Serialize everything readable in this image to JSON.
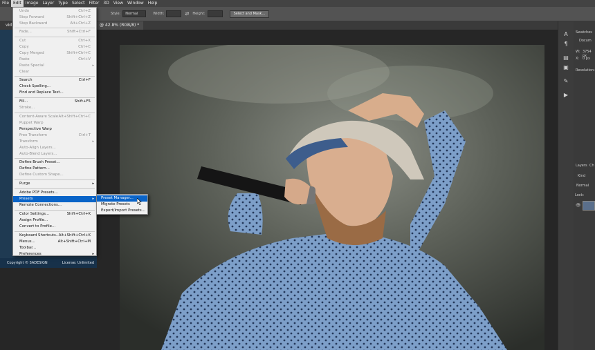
{
  "menubar": {
    "items": [
      "File",
      "Edit",
      "Image",
      "Layer",
      "Type",
      "Select",
      "Filter",
      "3D",
      "View",
      "Window",
      "Help"
    ]
  },
  "options": {
    "style_label": "Style:",
    "style_value": "Normal",
    "width_label": "Width:",
    "height_label": "Height:",
    "select_mask": "Select and Mask..."
  },
  "doc": {
    "tab_prefix": "vid",
    "tab_title": "@ 42.8% (RGB/8) *"
  },
  "edit_menu": {
    "items": [
      {
        "label": "Undo",
        "shortcut": "Ctrl+Z",
        "disabled": true
      },
      {
        "label": "Step Forward",
        "shortcut": "Shift+Ctrl+Z",
        "disabled": true
      },
      {
        "label": "Step Backward",
        "shortcut": "Alt+Ctrl+Z",
        "disabled": true
      },
      {
        "label": "Fade...",
        "shortcut": "Shift+Ctrl+F",
        "disabled": true
      },
      {
        "label": "Cut",
        "shortcut": "Ctrl+X",
        "disabled": true
      },
      {
        "label": "Copy",
        "shortcut": "Ctrl+C",
        "disabled": true
      },
      {
        "label": "Copy Merged",
        "shortcut": "Shift+Ctrl+C",
        "disabled": true
      },
      {
        "label": "Paste",
        "shortcut": "Ctrl+V",
        "disabled": true
      },
      {
        "label": "Paste Special",
        "shortcut": "",
        "disabled": true,
        "submenu": true
      },
      {
        "label": "Clear",
        "shortcut": "",
        "disabled": true
      },
      {
        "label": "Search",
        "shortcut": "Ctrl+F",
        "disabled": false
      },
      {
        "label": "Check Spelling...",
        "shortcut": "",
        "disabled": false
      },
      {
        "label": "Find and Replace Text...",
        "shortcut": "",
        "disabled": false
      },
      {
        "label": "Fill...",
        "shortcut": "Shift+F5",
        "disabled": false
      },
      {
        "label": "Stroke...",
        "shortcut": "",
        "disabled": true
      },
      {
        "label": "Content-Aware Scale",
        "shortcut": "Alt+Shift+Ctrl+C",
        "disabled": true
      },
      {
        "label": "Puppet Warp",
        "shortcut": "",
        "disabled": true
      },
      {
        "label": "Perspective Warp",
        "shortcut": "",
        "disabled": false
      },
      {
        "label": "Free Transform",
        "shortcut": "Ctrl+T",
        "disabled": true
      },
      {
        "label": "Transform",
        "shortcut": "",
        "disabled": true,
        "submenu": true
      },
      {
        "label": "Auto-Align Layers...",
        "shortcut": "",
        "disabled": true
      },
      {
        "label": "Auto-Blend Layers...",
        "shortcut": "",
        "disabled": true
      },
      {
        "label": "Define Brush Preset...",
        "shortcut": "",
        "disabled": false
      },
      {
        "label": "Define Pattern...",
        "shortcut": "",
        "disabled": false
      },
      {
        "label": "Define Custom Shape...",
        "shortcut": "",
        "disabled": true
      },
      {
        "label": "Purge",
        "shortcut": "",
        "disabled": false,
        "submenu": true
      },
      {
        "label": "Adobe PDF Presets...",
        "shortcut": "",
        "disabled": false
      },
      {
        "label": "Presets",
        "shortcut": "",
        "disabled": false,
        "submenu": true,
        "highlighted": true
      },
      {
        "label": "Remote Connections...",
        "shortcut": "",
        "disabled": false
      },
      {
        "label": "Color Settings...",
        "shortcut": "Shift+Ctrl+K",
        "disabled": false
      },
      {
        "label": "Assign Profile...",
        "shortcut": "",
        "disabled": false
      },
      {
        "label": "Convert to Profile...",
        "shortcut": "",
        "disabled": false
      },
      {
        "label": "Keyboard Shortcuts...",
        "shortcut": "Alt+Shift+Ctrl+K",
        "disabled": false
      },
      {
        "label": "Menus...",
        "shortcut": "Alt+Shift+Ctrl+M",
        "disabled": false
      },
      {
        "label": "Toolbar...",
        "shortcut": "",
        "disabled": false
      },
      {
        "label": "Preferences",
        "shortcut": "",
        "disabled": false,
        "submenu": true
      }
    ]
  },
  "presets_submenu": {
    "items": [
      "Preset Manager...",
      "Migrate Presets",
      "Export/Import Presets..."
    ]
  },
  "left_panel": {
    "footer_left": "Copyright © SADESIGN",
    "footer_right": "License: Unlimited"
  },
  "right_panel": {
    "swatches_tab": "Swatches",
    "doc_label": "Docum",
    "w_label": "W:",
    "w_value": "3754 px",
    "x_label": "X:",
    "x_value": "0 px",
    "resolution_label": "Resolution:",
    "layers_tab": "Layers",
    "channels_tab": "Ch",
    "kind_label": "Kind",
    "blend_label": "Normal",
    "lock_label": "Lock:"
  },
  "colors": {
    "menubar_bg": "#434343",
    "options_bg": "#535353",
    "menu_highlight": "#0a64c8",
    "left_panel_bg": "#1f3a52"
  }
}
